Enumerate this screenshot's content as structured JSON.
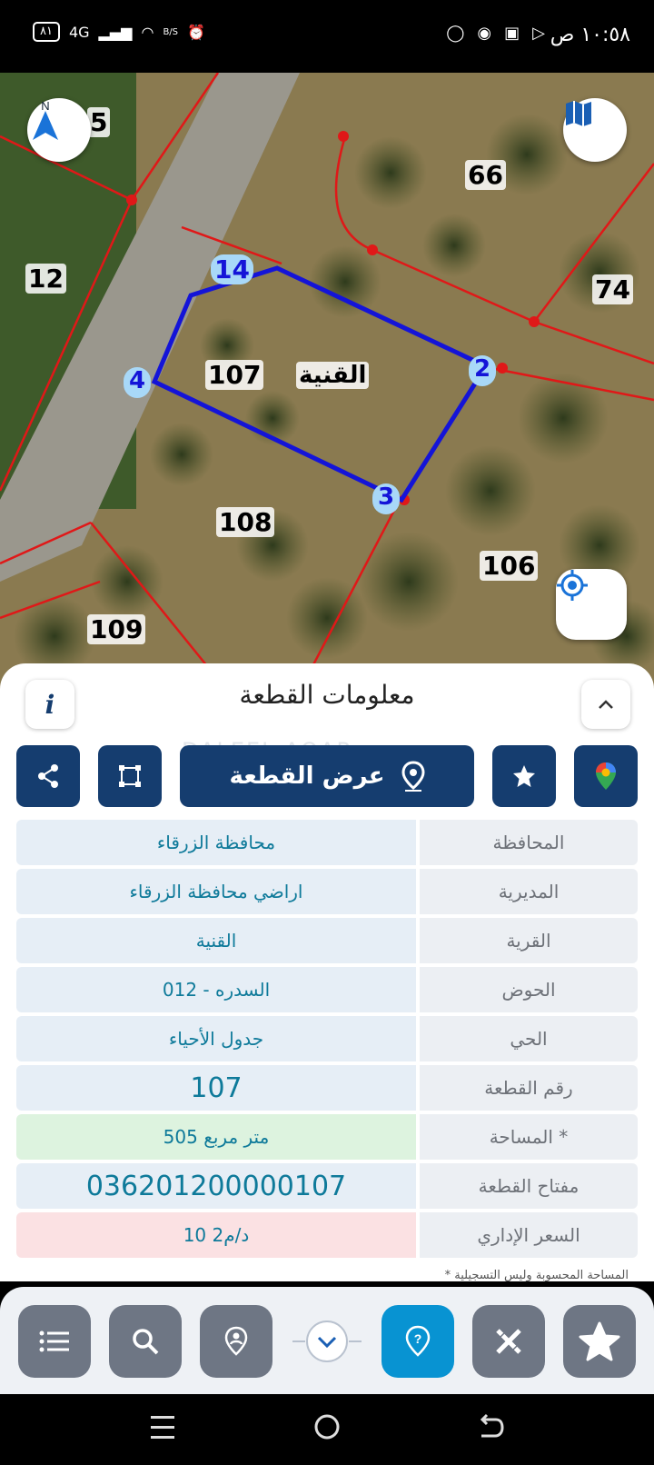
{
  "status_bar": {
    "time": "١٠:٥٨ ص",
    "battery": "٨١",
    "network": "4G",
    "speed": "B/S"
  },
  "map": {
    "parcel_labels": [
      "66",
      "74",
      "12",
      "107",
      "108",
      "106",
      "109"
    ],
    "current_parcel_name": "القنية",
    "vertex_labels": [
      "14",
      "2",
      "3",
      "4"
    ],
    "partial_label": "5",
    "colors": {
      "boundary": "#e01818",
      "selected": "#1414d8",
      "vertex": "#a8d8f8"
    }
  },
  "panel": {
    "title": "معلومات القطعة",
    "info_icon": "info-icon",
    "collapse_icon": "chevron-up-icon",
    "view_parcel_label": "عرض القطعة",
    "watermark": "DALEEL AQAR"
  },
  "parcel_info": {
    "rows": [
      {
        "label": "المحافظة",
        "value": "محافظة الزرقاء"
      },
      {
        "label": "المديرية",
        "value": "اراضي محافظة الزرقاء"
      },
      {
        "label": "القرية",
        "value": "القنية"
      },
      {
        "label": "الحوض",
        "value": "السدره - 012"
      },
      {
        "label": "الحي",
        "value": "جدول الأحياء"
      },
      {
        "label": "رقم القطعة",
        "value": "107"
      },
      {
        "label": "المساحة *",
        "value": "505  متر مربع"
      },
      {
        "label": "مفتاح القطعة",
        "value": "036201200000107"
      },
      {
        "label": "السعر الإداري",
        "value": "10 د/م2"
      }
    ],
    "row_colors": [
      "#e6eef6",
      "#e6eef6",
      "#e6eef6",
      "#e6eef6",
      "#e6eef6",
      "#e6eef6",
      "#ddf3df",
      "#e6eef6",
      "#fbe1e3"
    ],
    "footnote": "* المساحة المحسوبة وليس التسجيلية"
  },
  "bottom_nav": {
    "items": [
      "list-icon",
      "search-icon",
      "location-pin-icon",
      "chevron-down-icon",
      "help-pin-icon",
      "tools-icon",
      "star-icon"
    ]
  }
}
